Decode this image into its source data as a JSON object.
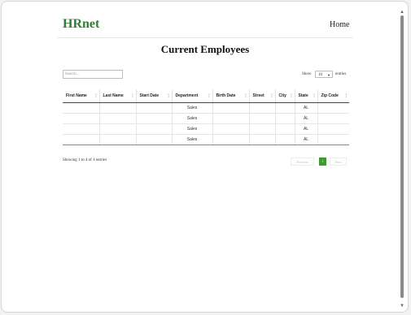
{
  "header": {
    "logo": "HRnet",
    "nav_home": "Home"
  },
  "page": {
    "title": "Current Employees"
  },
  "controls": {
    "search_placeholder": "Search...",
    "show_label": "Show",
    "entries_value": "10",
    "entries_label": "entries"
  },
  "table": {
    "columns": [
      "First Name",
      "Last Name",
      "Start Date",
      "Department",
      "Birth Date",
      "Street",
      "City",
      "State",
      "Zip Code"
    ],
    "rows": [
      [
        "",
        "",
        "",
        "Sales",
        "",
        "",
        "",
        "AL",
        ""
      ],
      [
        "",
        "",
        "",
        "Sales",
        "",
        "",
        "",
        "AL",
        ""
      ],
      [
        "",
        "",
        "",
        "Sales",
        "",
        "",
        "",
        "AL",
        ""
      ],
      [
        "",
        "",
        "",
        "Sales",
        "",
        "",
        "",
        "AL",
        ""
      ]
    ]
  },
  "footer": {
    "info": "Showing 1 to 4 of 4 entries",
    "previous": "Previous",
    "page": "1",
    "next": "Next"
  },
  "colors": {
    "brand": "#2f7d32",
    "active_page": "#3e9b2f"
  }
}
